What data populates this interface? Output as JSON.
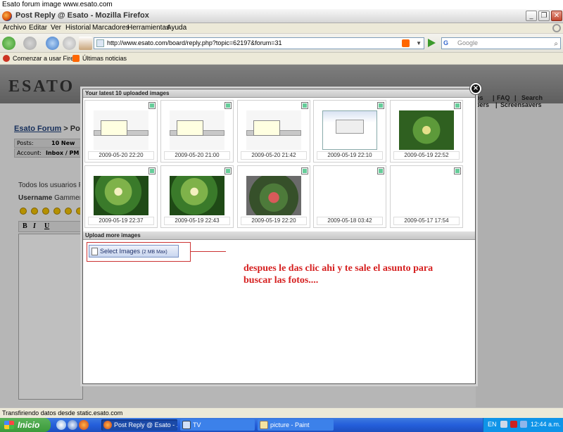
{
  "caption": "Esato forum image www.esato.com",
  "window": {
    "title": "Post Reply @ Esato - Mozilla Firefox",
    "minimize_icon": "minimize-icon",
    "maximize_icon": "restore-icon",
    "close_icon": "close-icon"
  },
  "menu": [
    "Archivo",
    "Editar",
    "Ver",
    "Historial",
    "Marcadores",
    "Herramientas",
    "Ayuda"
  ],
  "nav": {
    "url": "http://www.esato.com/board/reply.php?topic=62197&forum=31",
    "search_placeholder": "Google",
    "search_engine": "G"
  },
  "bookmarks": [
    "Comenzar a usar Fire...",
    "Últimas noticias"
  ],
  "site": {
    "logo": "ESATO",
    "topnav_1": [
      "os",
      "|",
      "FAQ",
      "|",
      "Search"
    ],
    "topnav_2": [
      "pers",
      "|",
      "Screensavers"
    ],
    "crumb_link": "Esato Forum",
    "crumb_rest": " > Post",
    "posts_label": "Posts:",
    "posts_value": "10 New",
    "account_label": "Account:",
    "account_value": "Inbox / PM",
    "todos": "Todos los usuarios P",
    "username_label": "Username",
    "username_value": "Gammer",
    "editor_buttons": [
      "B",
      "I",
      "U"
    ]
  },
  "modal": {
    "uploaded_header": "Your latest 10 uploaded images",
    "upload_header": "Upload more images",
    "close_label": "×",
    "images": [
      {
        "date": "2009-05-20 22:20",
        "kind": "shot"
      },
      {
        "date": "2009-05-20 21:00",
        "kind": "shot"
      },
      {
        "date": "2009-05-20 21:42",
        "kind": "shot"
      },
      {
        "date": "2009-05-19 22:10",
        "kind": "win"
      },
      {
        "date": "2009-05-19 22:52",
        "kind": "photo"
      },
      {
        "date": "2009-05-19 22:37",
        "kind": "photo2"
      },
      {
        "date": "2009-05-19 22:43",
        "kind": "photo2"
      },
      {
        "date": "2009-05-19 22:20",
        "kind": "photo3"
      },
      {
        "date": "2009-05-18 03:42",
        "kind": "blank"
      },
      {
        "date": "2009-05-17 17:54",
        "kind": "blank"
      }
    ],
    "select_label": "Select Images",
    "select_note": "(2 MB Max)"
  },
  "annotation": "despues le das clic ahi y te sale el asunto para buscar las fotos....",
  "status": "Transfiriendo datos desde static.esato.com",
  "taskbar": {
    "start": "Inicio",
    "tasks": [
      "Post Reply @ Esato - ...",
      "TV",
      "picture - Paint"
    ],
    "lang": "EN",
    "time": "12:44 a.m."
  },
  "colors": {
    "annotation": "#d62020",
    "link": "#1e3f7a",
    "taskbar": "#245edb"
  }
}
